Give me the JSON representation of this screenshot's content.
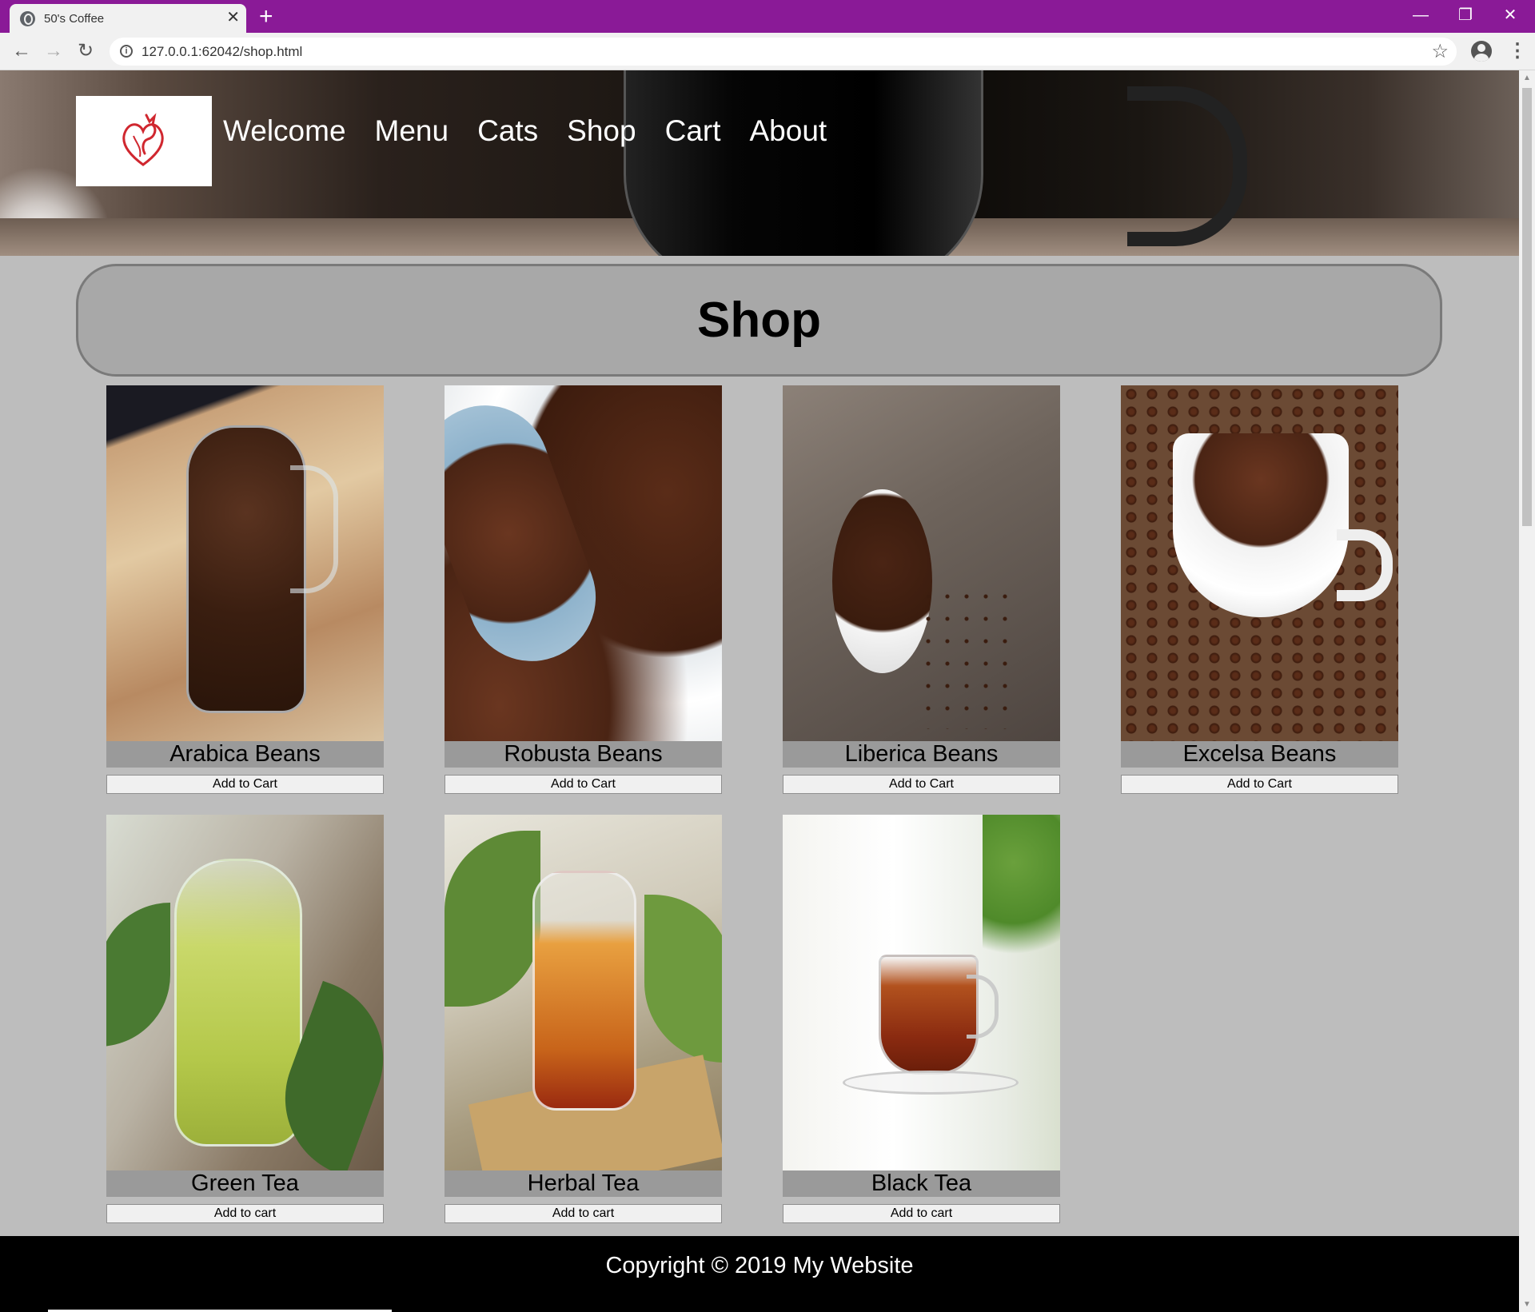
{
  "browser": {
    "tab_title": "50's Coffee",
    "tab_close": "✕",
    "new_tab": "+",
    "url": "127.0.0.1:62042/shop.html",
    "controls": {
      "minimize": "—",
      "restore": "❐",
      "close": "✕"
    },
    "nav": {
      "back": "←",
      "forward": "→",
      "reload": "↻"
    },
    "info_glyph": "i",
    "bookmark_glyph": "☆",
    "menu_glyph": "⋮",
    "accent_color": "#8a1a97"
  },
  "site": {
    "nav": [
      "Welcome",
      "Menu",
      "Cats",
      "Shop",
      "Cart",
      "About"
    ],
    "page_title": "Shop",
    "products": [
      {
        "name": "Arabica Beans",
        "button": "Add to Cart"
      },
      {
        "name": "Robusta Beans",
        "button": "Add to Cart"
      },
      {
        "name": "Liberica Beans",
        "button": "Add to Cart"
      },
      {
        "name": "Excelsa Beans",
        "button": "Add to Cart"
      },
      {
        "name": "Green Tea",
        "button": "Add to cart"
      },
      {
        "name": "Herbal Tea",
        "button": "Add to cart"
      },
      {
        "name": "Black Tea",
        "button": "Add to cart"
      }
    ],
    "footer": "Copyright © 2019 My Website"
  },
  "scrollbar": {
    "up": "▲",
    "down": "▼"
  }
}
